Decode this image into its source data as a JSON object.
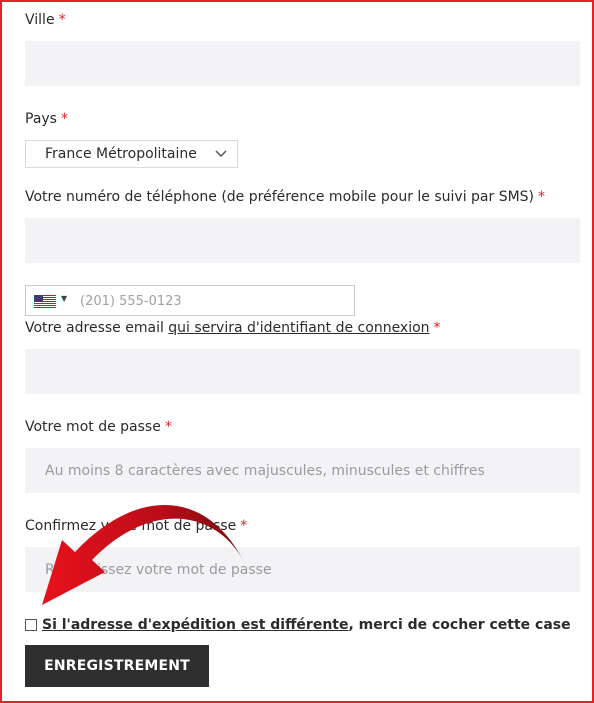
{
  "form": {
    "required_mark": "*",
    "city": {
      "label": "Ville",
      "value": ""
    },
    "country": {
      "label": "Pays",
      "selected": "France Métropolitaine"
    },
    "phone_label": {
      "label": "Votre numéro de téléphone (de préférence mobile pour le suivi par SMS)",
      "value": ""
    },
    "phone_intl": {
      "flag": "us-flag-icon",
      "placeholder": "(201) 555-0123"
    },
    "email": {
      "label_prefix": "Votre adresse email ",
      "label_link": "qui servira d'identifiant de connexion",
      "value": ""
    },
    "password": {
      "label": "Votre mot de passe",
      "placeholder": "Au moins 8 caractères avec majuscules, minuscules et chiffres"
    },
    "confirm_password": {
      "label": "Confirmez votre mot de passe",
      "placeholder": "Ressaisissez votre mot de passe"
    },
    "shipping_checkbox": {
      "link_text": "Si l'adresse d'expédition est différente",
      "rest_text": ", merci de cocher cette case",
      "checked": false
    },
    "submit_label": "ENREGISTREMENT"
  },
  "colors": {
    "frame": "#e32327",
    "required": "#e32327",
    "field_bg": "#f3f3f5",
    "button_bg": "#2f2f30",
    "arrow": "#c8101a"
  },
  "annotation": {
    "type": "curved-arrow-icon"
  }
}
